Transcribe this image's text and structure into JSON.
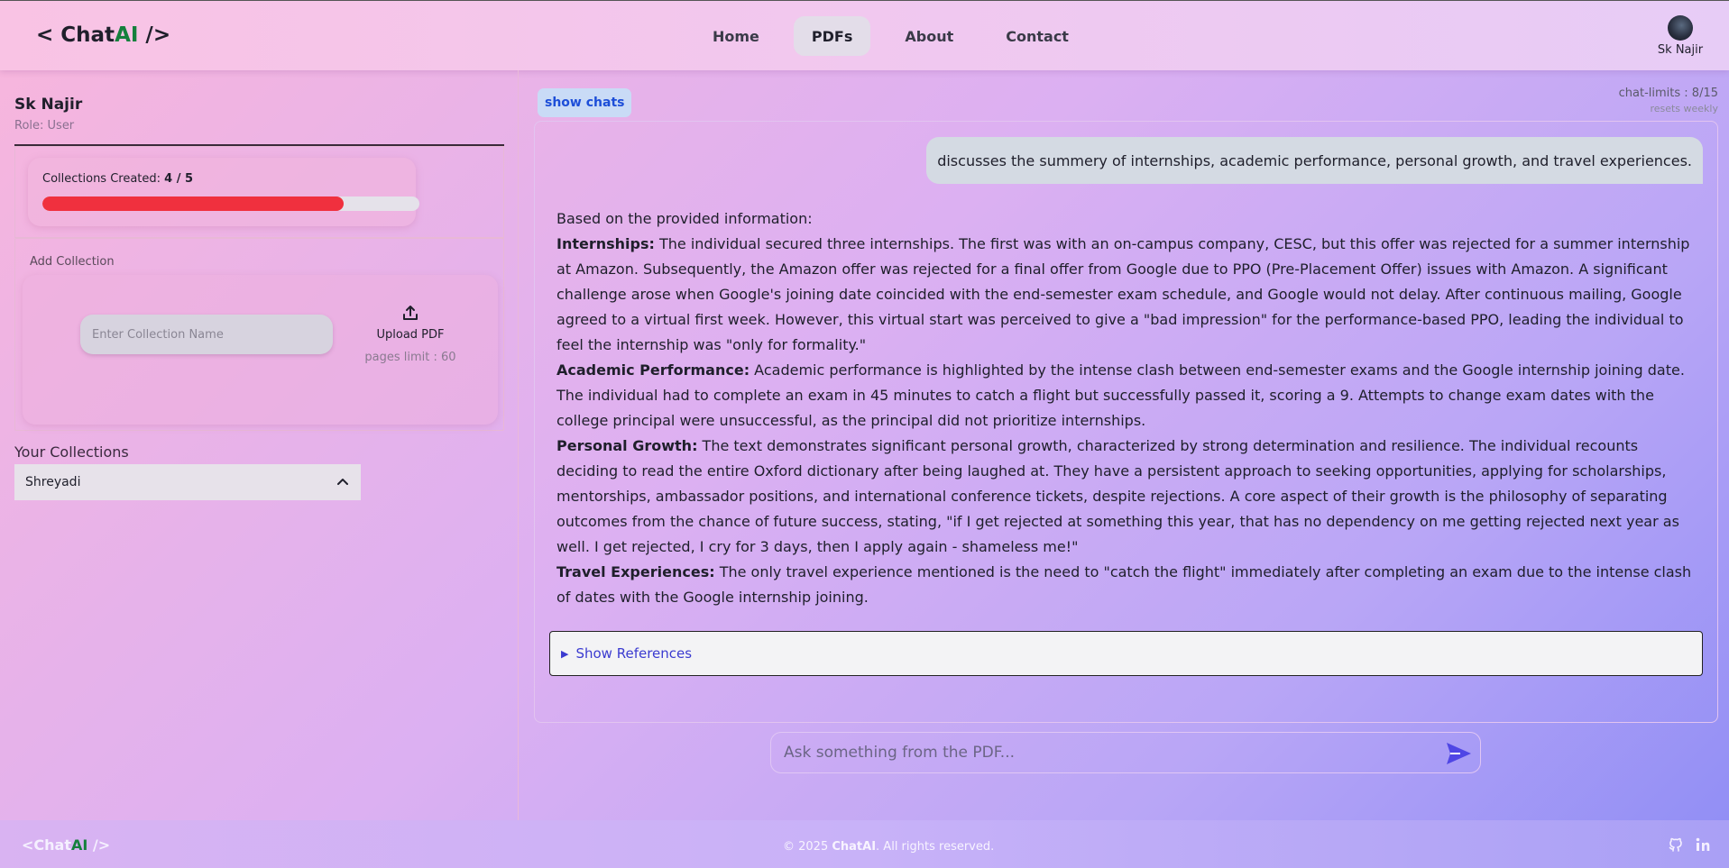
{
  "header": {
    "logo_prefix": "< Chat",
    "logo_ai": "AI",
    "logo_suffix": " />",
    "nav": [
      {
        "label": "Home"
      },
      {
        "label": "PDFs"
      },
      {
        "label": "About"
      },
      {
        "label": "Contact"
      }
    ],
    "active_nav": "PDFs",
    "user_name": "Sk Najir"
  },
  "sidebar": {
    "user_name": "Sk Najir",
    "role": "Role: User",
    "collections_label": "Collections Created: ",
    "collections_count": "4 / 5",
    "collections_fraction": 0.8,
    "progress_color": "#f0303e",
    "add_collection_title": "Add Collection",
    "collection_input_placeholder": "Enter Collection Name",
    "upload_label": "Upload PDF",
    "pages_limit": "pages limit : 60",
    "your_collections": "Your Collections",
    "selected_collection": "Shreyadi"
  },
  "chat": {
    "show_chats": "show chats",
    "limits": "chat-limits : 8/15",
    "resets": "resets weekly",
    "user_message": "discusses the summery of internships, academic performance, personal growth, and travel experiences.",
    "answer_intro": "Based on the provided information:",
    "sections": [
      {
        "heading": "Internships:",
        "text": " The individual secured three internships. The first was with an on-campus company, CESC, but this offer was rejected for a summer internship at Amazon. Subsequently, the Amazon offer was rejected for a final offer from Google due to PPO (Pre-Placement Offer) issues with Amazon. A significant challenge arose when Google's joining date coincided with the end-semester exam schedule, and Google would not delay. After continuous mailing, Google agreed to a virtual first week. However, this virtual start was perceived to give a \"bad impression\" for the performance-based PPO, leading the individual to feel the internship was \"only for formality.\""
      },
      {
        "heading": "Academic Performance:",
        "text": " Academic performance is highlighted by the intense clash between end-semester exams and the Google internship joining date. The individual had to complete an exam in 45 minutes to catch a flight but successfully passed it, scoring a 9. Attempts to change exam dates with the college principal were unsuccessful, as the principal did not prioritize internships."
      },
      {
        "heading": "Personal Growth:",
        "text": " The text demonstrates significant personal growth, characterized by strong determination and resilience. The individual recounts deciding to read the entire Oxford dictionary after being laughed at. They have a persistent approach to seeking opportunities, applying for scholarships, mentorships, ambassador positions, and international conference tickets, despite rejections. A core aspect of their growth is the philosophy of separating outcomes from the chance of future success, stating, \"if I get rejected at something this year, that has no dependency on me getting rejected next year as well. I get rejected, I cry for 3 days, then I apply again - shameless me!\""
      },
      {
        "heading": "Travel Experiences:",
        "text": " The only travel experience mentioned is the need to \"catch the flight\" immediately after completing an exam due to the intense clash of dates with the Google internship joining."
      }
    ],
    "show_references": "Show References",
    "ask_placeholder": "Ask something from the PDF...",
    "send_color": "#4f46e5"
  },
  "footer": {
    "logo_prefix": "<Chat",
    "logo_ai": "AI",
    "logo_suffix": " />",
    "copyright_prefix": "© 2025 ",
    "copyright_brand": "ChatAI",
    "copyright_suffix": ". All rights reserved.",
    "icons": [
      "github-icon",
      "linkedin-icon"
    ]
  }
}
